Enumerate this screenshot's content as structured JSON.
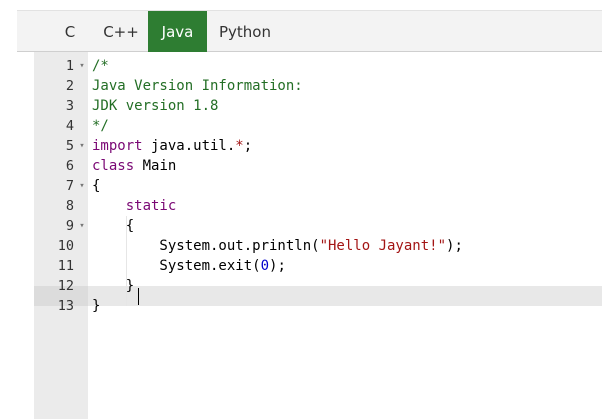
{
  "tabs": [
    {
      "label": "C",
      "active": false
    },
    {
      "label": "C++",
      "active": false
    },
    {
      "label": "Java",
      "active": true
    },
    {
      "label": "Python",
      "active": false
    }
  ],
  "colors": {
    "active_tab": "#2e7d32",
    "comment": "#236e25",
    "keyword": "#7a0874",
    "string": "#a31515",
    "number": "#0000cd"
  },
  "editor": {
    "active_line": 12,
    "lines": [
      {
        "number": "1",
        "fold": true,
        "text": "/*"
      },
      {
        "number": "2",
        "fold": false,
        "text": "Java Version Information:"
      },
      {
        "number": "3",
        "fold": false,
        "text": "JDK version 1.8"
      },
      {
        "number": "4",
        "fold": false,
        "text": "*/"
      },
      {
        "number": "5",
        "fold": true,
        "text": "import java.util.*;"
      },
      {
        "number": "6",
        "fold": false,
        "text": "class Main"
      },
      {
        "number": "7",
        "fold": true,
        "text": "{"
      },
      {
        "number": "8",
        "fold": false,
        "text": "    static"
      },
      {
        "number": "9",
        "fold": true,
        "text": "    {"
      },
      {
        "number": "10",
        "fold": false,
        "text": "        System.out.println(\"Hello Jayant!\");"
      },
      {
        "number": "11",
        "fold": false,
        "text": "        System.exit(0);"
      },
      {
        "number": "12",
        "fold": false,
        "text": "    }"
      },
      {
        "number": "13",
        "fold": false,
        "text": "}"
      }
    ],
    "tokens": {
      "l1": "/*",
      "l2": "Java Version Information:",
      "l3": "JDK version 1.8",
      "l4": "*/",
      "l5_kw": "import",
      "l5_mid": " java.util.",
      "l5_star": "*",
      "l5_end": ";",
      "l6_kw": "class",
      "l6_rest": " Main",
      "l7": "{",
      "l8_indent": "    ",
      "l8_kw": "static",
      "l9": "    {",
      "l10_pre": "        System.out.println(",
      "l10_str": "\"Hello Jayant!\"",
      "l10_post": ");",
      "l11_pre": "        System.exit(",
      "l11_num": "0",
      "l11_post": ");",
      "l12": "    }",
      "l13": "}"
    }
  }
}
